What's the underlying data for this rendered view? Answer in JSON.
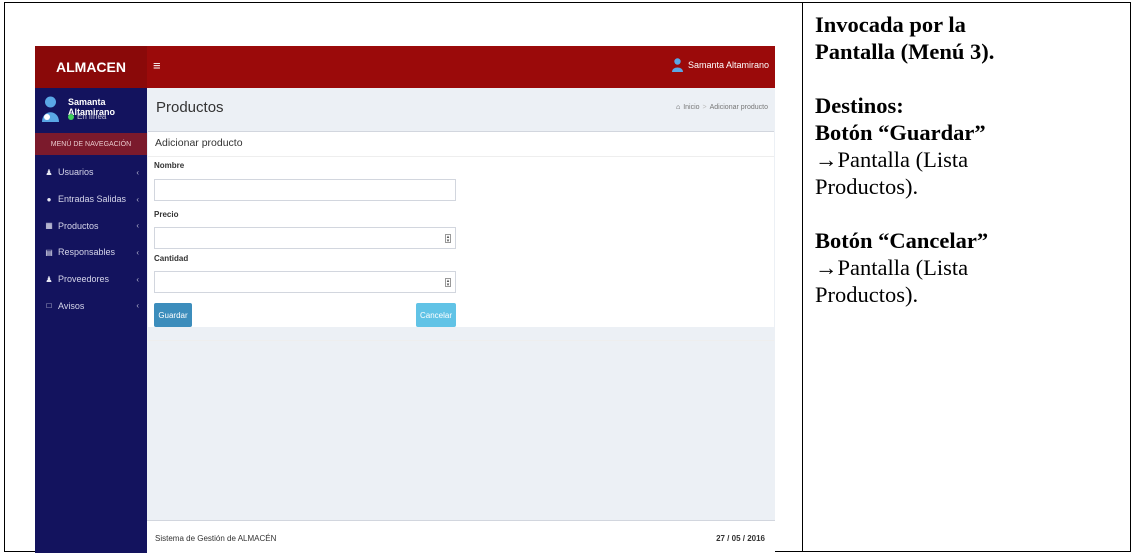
{
  "app": {
    "logo": "ALMACEN",
    "menu_toggle_icon": "hamburger-icon",
    "top_user_name": "Samanta Altamirano"
  },
  "sidebar": {
    "user_name": "Samanta Altamirano",
    "user_status": "En línea",
    "nav_header": "MENÚ DE NAVEGACIÓN",
    "items": [
      {
        "label": "Usuarios",
        "icon": "user-icon"
      },
      {
        "label": "Entradas Salidas",
        "icon": "circle-icon"
      },
      {
        "label": "Productos",
        "icon": "table-icon"
      },
      {
        "label": "Responsables",
        "icon": "card-icon"
      },
      {
        "label": "Proveedores",
        "icon": "user-icon"
      },
      {
        "label": "Avisos",
        "icon": "monitor-icon"
      }
    ]
  },
  "page": {
    "title": "Productos",
    "breadcrumb": [
      "Inicio",
      "Adicionar producto"
    ]
  },
  "form": {
    "box_title": "Adicionar producto",
    "fields": [
      {
        "label": "Nombre",
        "value": ""
      },
      {
        "label": "Precio",
        "value": ""
      },
      {
        "label": "Cantidad",
        "value": ""
      }
    ],
    "save_label": "Guardar",
    "cancel_label": "Cancelar"
  },
  "footer": {
    "left": "Sistema de Gestión de ALMACÉN",
    "right": "27 / 05 / 2016"
  },
  "description": {
    "invoked_line1": "Invocada por la",
    "invoked_line2": "Pantalla (Menú 3).",
    "destinos": "Destinos:",
    "save_button": "Botón “Guardar”",
    "save_target_1": "→Pantalla (Lista",
    "save_target_2": "Productos).",
    "cancel_button": "Botón “Cancelar”",
    "cancel_target_1": "→Pantalla (Lista",
    "cancel_target_2": "Productos)."
  },
  "colors": {
    "topbar": "#9b0a0a",
    "sidebar": "#13135e",
    "nav_header": "#7b1a2c",
    "primary_button": "#3c8dbc",
    "info_button": "#61c3e6"
  }
}
